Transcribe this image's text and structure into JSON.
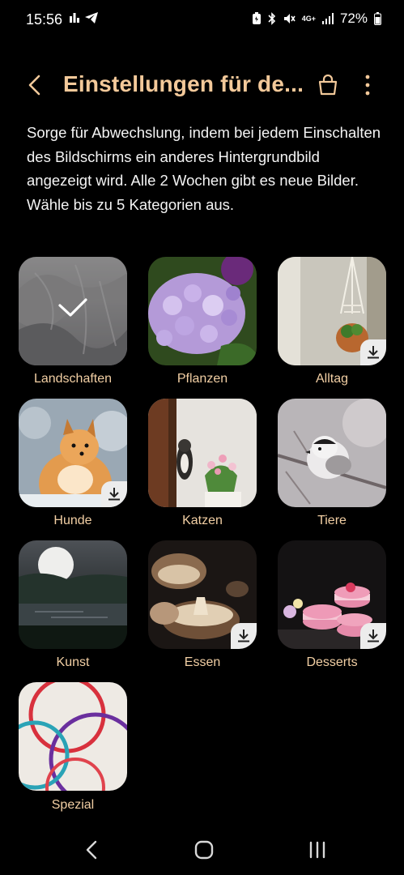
{
  "status_bar": {
    "time": "15:56",
    "network_label": "4G+",
    "battery_percent": "72%"
  },
  "header": {
    "title": "Einstellungen für de...",
    "back_icon": "back-arrow-icon",
    "bag_icon": "shopping-bag-icon",
    "more_icon": "more-vertical-icon",
    "accent_color": "#f3c99a"
  },
  "description": "Sorge für Abwechslung, indem bei jedem Einschalten des Bildschirms ein anderes Hintergrundbild angezeigt wird. Alle 2 Wochen gibt es neue Bilder. Wähle bis zu 5 Kategorien aus.",
  "categories": [
    {
      "label": "Landschaften",
      "selected": true,
      "download": false
    },
    {
      "label": "Pflanzen",
      "selected": false,
      "download": false
    },
    {
      "label": "Alltag",
      "selected": false,
      "download": true
    },
    {
      "label": "Hunde",
      "selected": false,
      "download": true
    },
    {
      "label": "Katzen",
      "selected": false,
      "download": false
    },
    {
      "label": "Tiere",
      "selected": false,
      "download": false
    },
    {
      "label": "Kunst",
      "selected": false,
      "download": false
    },
    {
      "label": "Essen",
      "selected": false,
      "download": true
    },
    {
      "label": "Desserts",
      "selected": false,
      "download": true
    },
    {
      "label": "Spezial",
      "selected": false,
      "download": false
    }
  ],
  "nav_bar": {
    "back_icon": "nav-back-icon",
    "home_icon": "nav-home-icon",
    "recents_icon": "nav-recents-icon"
  }
}
